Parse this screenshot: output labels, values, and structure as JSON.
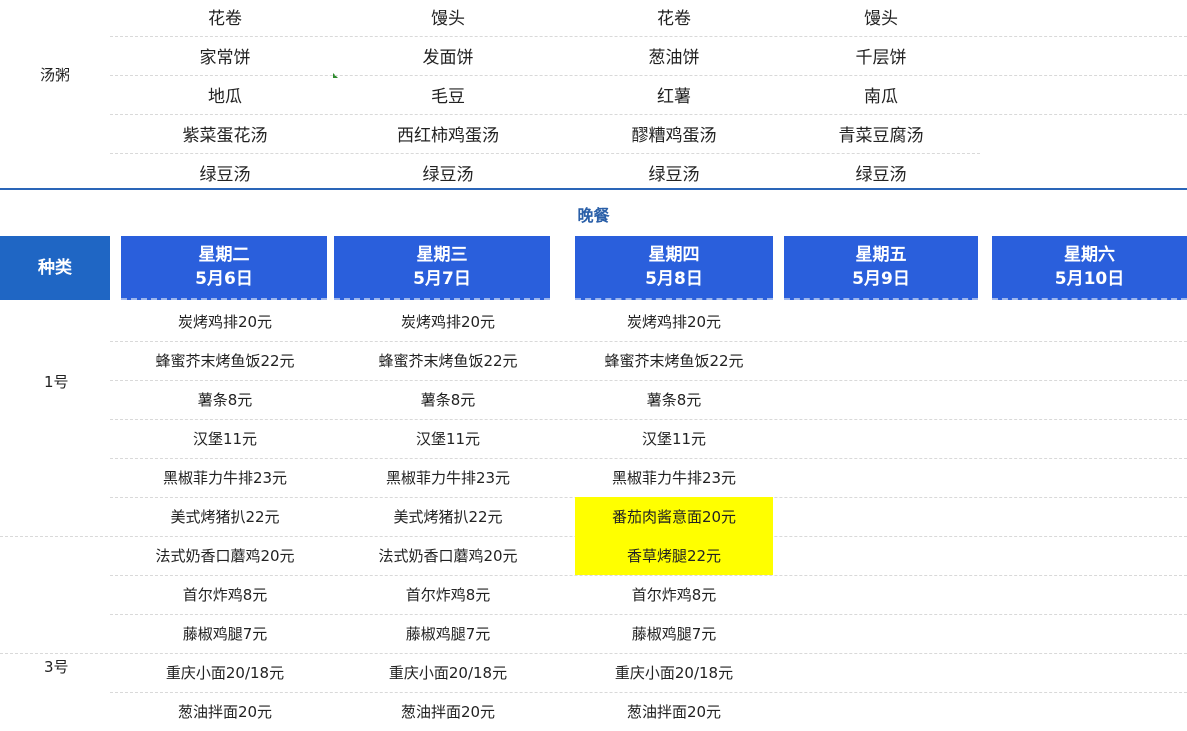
{
  "colors": {
    "header_blue": "#2a5fdc",
    "header_dark": "#1f66c4",
    "separator": "#2a65b8",
    "highlight": "#ffff00",
    "title": "#2a5fa8"
  },
  "lunch_section": {
    "row_label": "汤粥",
    "rows": [
      [
        "花卷",
        "馒头",
        "花卷",
        "馒头"
      ],
      [
        "家常饼",
        "发面饼",
        "葱油饼",
        "千层饼"
      ],
      [
        "地瓜",
        "毛豆",
        "红薯",
        "南瓜"
      ],
      [
        "紫菜蛋花汤",
        "西红柿鸡蛋汤",
        "醪糟鸡蛋汤",
        "青菜豆腐汤"
      ],
      [
        "绿豆汤",
        "绿豆汤",
        "绿豆汤",
        "绿豆汤"
      ]
    ]
  },
  "dinner": {
    "title": "晚餐",
    "header": {
      "category": "种类",
      "days": [
        {
          "weekday": "星期二",
          "date": "5月6日"
        },
        {
          "weekday": "星期三",
          "date": "5月7日"
        },
        {
          "weekday": "星期四",
          "date": "5月8日"
        },
        {
          "weekday": "星期五",
          "date": "5月9日"
        },
        {
          "weekday": "星期六",
          "date": "5月10日"
        }
      ]
    },
    "group_labels": {
      "g1": "1号",
      "g3": "3号"
    },
    "rows": [
      [
        "炭烤鸡排20元",
        "炭烤鸡排20元",
        "炭烤鸡排20元"
      ],
      [
        "蜂蜜芥末烤鱼饭22元",
        "蜂蜜芥末烤鱼饭22元",
        "蜂蜜芥末烤鱼饭22元"
      ],
      [
        "薯条8元",
        "薯条8元",
        "薯条8元"
      ],
      [
        "汉堡11元",
        "汉堡11元",
        "汉堡11元"
      ],
      [
        "黑椒菲力牛排23元",
        "黑椒菲力牛排23元",
        "黑椒菲力牛排23元"
      ],
      [
        "美式烤猪扒22元",
        "美式烤猪扒22元",
        "番茄肉酱意面20元"
      ],
      [
        "法式奶香口蘑鸡20元",
        "法式奶香口蘑鸡20元",
        "香草烤腿22元"
      ],
      [
        "首尔炸鸡8元",
        "首尔炸鸡8元",
        "首尔炸鸡8元"
      ],
      [
        "藤椒鸡腿7元",
        "藤椒鸡腿7元",
        "藤椒鸡腿7元"
      ],
      [
        "重庆小面20/18元",
        "重庆小面20/18元",
        "重庆小面20/18元"
      ],
      [
        "葱油拌面20元",
        "葱油拌面20元",
        "葱油拌面20元"
      ]
    ]
  }
}
